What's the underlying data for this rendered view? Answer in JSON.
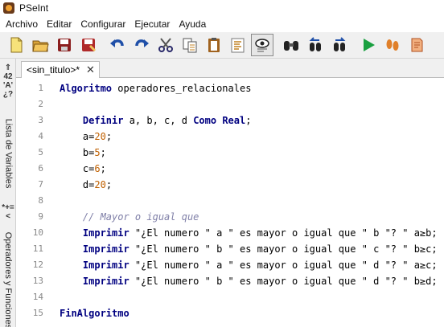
{
  "window": {
    "title": "PSeInt"
  },
  "menu": [
    "Archivo",
    "Editar",
    "Configurar",
    "Ejecutar",
    "Ayuda"
  ],
  "toolbar": [
    {
      "name": "new-file-icon"
    },
    {
      "name": "open-file-icon"
    },
    {
      "name": "save-icon"
    },
    {
      "name": "save-as-icon"
    },
    {
      "name": "undo-icon"
    },
    {
      "name": "redo-icon"
    },
    {
      "name": "cut-icon"
    },
    {
      "name": "copy-icon"
    },
    {
      "name": "paste-icon"
    },
    {
      "name": "format-icon"
    },
    {
      "name": "inspect-icon"
    },
    {
      "name": "search-icon"
    },
    {
      "name": "replace-prev-icon"
    },
    {
      "name": "replace-next-icon"
    },
    {
      "name": "run-icon"
    },
    {
      "name": "step-icon"
    },
    {
      "name": "export-icon"
    }
  ],
  "sidebar": {
    "symbols_top": "⇑42\n'A'\n¿?",
    "tab_variables": "Lista de Variables",
    "symbols_mid": "*+=<",
    "tab_operators": "Operadores y Funciones"
  },
  "editor_tab": {
    "label": "<sin_titulo>*",
    "close": "✕"
  },
  "code_lines": [
    {
      "n": "1",
      "parts": [
        {
          "t": "Algoritmo",
          "c": "kw"
        },
        {
          "t": " operadores_relacionales",
          "c": ""
        }
      ]
    },
    {
      "n": "2",
      "parts": []
    },
    {
      "n": "3",
      "parts": [
        {
          "t": "    ",
          "c": ""
        },
        {
          "t": "Definir",
          "c": "kw"
        },
        {
          "t": " a, b, c, d ",
          "c": ""
        },
        {
          "t": "Como",
          "c": "kw"
        },
        {
          "t": " ",
          "c": ""
        },
        {
          "t": "Real",
          "c": "kw"
        },
        {
          "t": ";",
          "c": ""
        }
      ]
    },
    {
      "n": "4",
      "parts": [
        {
          "t": "    a=",
          "c": ""
        },
        {
          "t": "20",
          "c": "num"
        },
        {
          "t": ";",
          "c": ""
        }
      ]
    },
    {
      "n": "5",
      "parts": [
        {
          "t": "    b=",
          "c": ""
        },
        {
          "t": "5",
          "c": "num"
        },
        {
          "t": ";",
          "c": ""
        }
      ]
    },
    {
      "n": "6",
      "parts": [
        {
          "t": "    c=",
          "c": ""
        },
        {
          "t": "6",
          "c": "num"
        },
        {
          "t": ";",
          "c": ""
        }
      ]
    },
    {
      "n": "7",
      "parts": [
        {
          "t": "    d=",
          "c": ""
        },
        {
          "t": "20",
          "c": "num"
        },
        {
          "t": ";",
          "c": ""
        }
      ]
    },
    {
      "n": "8",
      "parts": []
    },
    {
      "n": "9",
      "parts": [
        {
          "t": "    // Mayor o igual que",
          "c": "cmt"
        }
      ]
    },
    {
      "n": "10",
      "parts": [
        {
          "t": "    ",
          "c": ""
        },
        {
          "t": "Imprimir",
          "c": "kw"
        },
        {
          "t": " \"¿El numero \" a \" es mayor o igual que \" b \"? \" a≥b;",
          "c": "str"
        }
      ]
    },
    {
      "n": "11",
      "parts": [
        {
          "t": "    ",
          "c": ""
        },
        {
          "t": "Imprimir",
          "c": "kw"
        },
        {
          "t": " \"¿El numero \" b \" es mayor o igual que \" c \"? \" b≥c;",
          "c": "str"
        }
      ]
    },
    {
      "n": "12",
      "parts": [
        {
          "t": "    ",
          "c": ""
        },
        {
          "t": "Imprimir",
          "c": "kw"
        },
        {
          "t": " \"¿El numero \" a \" es mayor o igual que \" d \"? \" a≥c;",
          "c": "str"
        }
      ]
    },
    {
      "n": "13",
      "parts": [
        {
          "t": "    ",
          "c": ""
        },
        {
          "t": "Imprimir",
          "c": "kw"
        },
        {
          "t": " \"¿El numero \" b \" es mayor o igual que \" d \"? \" b≥d;",
          "c": "str"
        }
      ]
    },
    {
      "n": "14",
      "parts": []
    },
    {
      "n": "15",
      "parts": [
        {
          "t": "FinAlgoritmo",
          "c": "kw"
        }
      ]
    }
  ],
  "colors": {
    "keyword": "#000080",
    "number": "#c06000",
    "comment": "#8080a8"
  }
}
